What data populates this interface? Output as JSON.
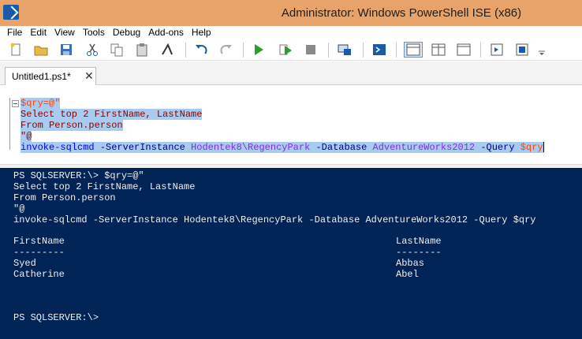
{
  "window": {
    "title": "Administrator: Windows PowerShell ISE (x86)"
  },
  "menu": {
    "items": [
      "File",
      "Edit",
      "View",
      "Tools",
      "Debug",
      "Add-ons",
      "Help"
    ]
  },
  "toolbar": {
    "icons": [
      "new-icon",
      "open-icon",
      "save-icon",
      "cut-icon",
      "copy-icon",
      "paste-icon",
      "clear-icon",
      "undo-icon",
      "redo-icon",
      "run-icon",
      "run-selection-icon",
      "stop-icon",
      "remote-powershell-icon",
      "start-powershell-icon",
      "layout-top-icon",
      "layout-right-icon",
      "layout-max-icon",
      "show-script-icon",
      "show-commands-icon"
    ]
  },
  "tabs": [
    {
      "label": "Untitled1.ps1*",
      "close": "✕"
    }
  ],
  "editor": {
    "line1": "$qry=@\"",
    "line2": "Select top 2 FirstName, LastName",
    "line3": "From Person.person",
    "line4": "\"@",
    "line5_cmd": "invoke-sqlcmd",
    "line5_p1": " -ServerInstance ",
    "line5_a1": "Hodentek8\\RegencyPark",
    "line5_p2": " -Database ",
    "line5_a2": "AdventureWorks2012",
    "line5_p3": " -Query ",
    "line5_v": "$qry"
  },
  "console": {
    "lines": [
      "PS SQLSERVER:\\> $qry=@\"",
      "Select top 2 FirstName, LastName",
      "From Person.person",
      "\"@",
      "invoke-sqlcmd -ServerInstance Hodentek8\\RegencyPark -Database AdventureWorks2012 -Query $qry"
    ],
    "table": {
      "headers": [
        "FirstName",
        "LastName"
      ],
      "separators": [
        "---------",
        "--------"
      ],
      "rows": [
        [
          "Syed",
          "Abbas"
        ],
        [
          "Catherine",
          "Abel"
        ]
      ]
    },
    "prompt": "PS SQLSERVER:\\>"
  },
  "colors": {
    "title_bar": "#e8a36b",
    "console_bg": "#012456",
    "selection": "#aacbf0"
  }
}
